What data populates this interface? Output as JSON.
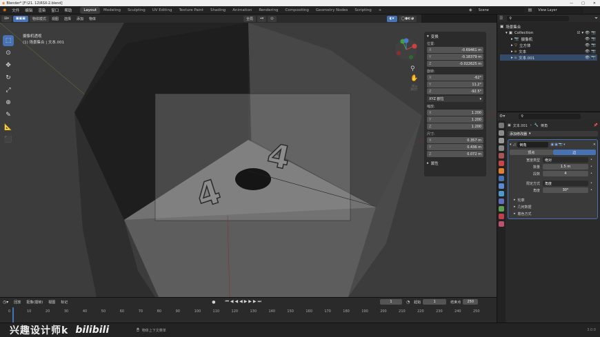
{
  "window": {
    "title": "Blender* [F:\\21. 12\\RSX-2.blend]",
    "controls": [
      "—",
      "□",
      "✕"
    ]
  },
  "menus": [
    "文件",
    "编辑",
    "渲染",
    "窗口",
    "帮助"
  ],
  "workspaces": [
    "Layout",
    "Modeling",
    "Sculpting",
    "UV Editing",
    "Texture Paint",
    "Shading",
    "Animation",
    "Rendering",
    "Compositing",
    "Geometry Nodes",
    "Scripting",
    "+"
  ],
  "workspace_active": "Layout",
  "scene": "Scene",
  "view_layer": "View Layer",
  "viewport_header": {
    "mode": "物体模式",
    "menus": [
      "视图",
      "选择",
      "添加",
      "物体"
    ],
    "orientation": "全局"
  },
  "viewport": {
    "camera_label": "摄像机透视",
    "object_label": "(1) 场景集合 | 文本.001",
    "digit": "4"
  },
  "n_panel": {
    "title": "变换",
    "location_label": "位置:",
    "location": [
      {
        "axis": "X",
        "value": "-0.69461 m"
      },
      {
        "axis": "Y",
        "value": "-0.18379 m"
      },
      {
        "axis": "Z",
        "value": "-0.022625 m"
      }
    ],
    "rotation_label": "旋转:",
    "rotation": [
      {
        "axis": "X",
        "value": "-62°"
      },
      {
        "axis": "Y",
        "value": "11.2°"
      },
      {
        "axis": "Z",
        "value": "-92.5°"
      }
    ],
    "rotation_mode": "XYZ 欧拉",
    "scale_label": "缩放:",
    "scale": [
      {
        "axis": "X",
        "value": "1.200"
      },
      {
        "axis": "Y",
        "value": "1.200"
      },
      {
        "axis": "Z",
        "value": "1.200"
      }
    ],
    "dimensions_label": "尺寸:",
    "dimensions": [
      {
        "axis": "X",
        "value": "0.357 m"
      },
      {
        "axis": "Y",
        "value": "0.436 m"
      },
      {
        "axis": "Z",
        "value": "0.072 m"
      }
    ],
    "properties": "属性"
  },
  "outliner": {
    "search_placeholder": "",
    "root": "场景集合",
    "items": [
      {
        "name": "Collection"
      },
      {
        "name": "摄像机"
      },
      {
        "name": "立方体"
      },
      {
        "name": "文本"
      },
      {
        "name": "文本.001"
      }
    ]
  },
  "properties": {
    "object": "文本.001",
    "modifier_tab": "倒角",
    "add_modifier": "添加修改器",
    "modifier_name": "倒角",
    "affect": [
      "顶点",
      "边"
    ],
    "affect_active": "边",
    "width_type_label": "宽度类型",
    "width_type": "绝对",
    "amount_label": "数量",
    "amount": "1.5 m",
    "segments_label": "段数",
    "segments": "4",
    "limit_method_label": "限定方式",
    "limit_method": "角度",
    "angle_label": "角度",
    "angle": "30°",
    "sections": [
      "轮廓",
      "几何数据",
      "着色方式"
    ]
  },
  "timeline": {
    "menus": [
      "回放",
      "抠像(插帧)",
      "视图",
      "标记"
    ],
    "current_frame": "1",
    "start_label": "起始",
    "start": "1",
    "end_label": "结束点",
    "end": "250",
    "ticks": [
      "0",
      "10",
      "20",
      "30",
      "40",
      "50",
      "60",
      "70",
      "80",
      "90",
      "100",
      "110",
      "120",
      "130",
      "140",
      "150",
      "160",
      "170",
      "180",
      "190",
      "200",
      "210",
      "220",
      "230",
      "240",
      "250"
    ]
  },
  "statusbar": {
    "hint": "物体上下文菜单",
    "version": "3.0.0",
    "watermark": "兴趣设计师k",
    "logo": "bilibili"
  },
  "colors": {
    "accent": "#4772b3",
    "bg": "#1d1d1d"
  }
}
